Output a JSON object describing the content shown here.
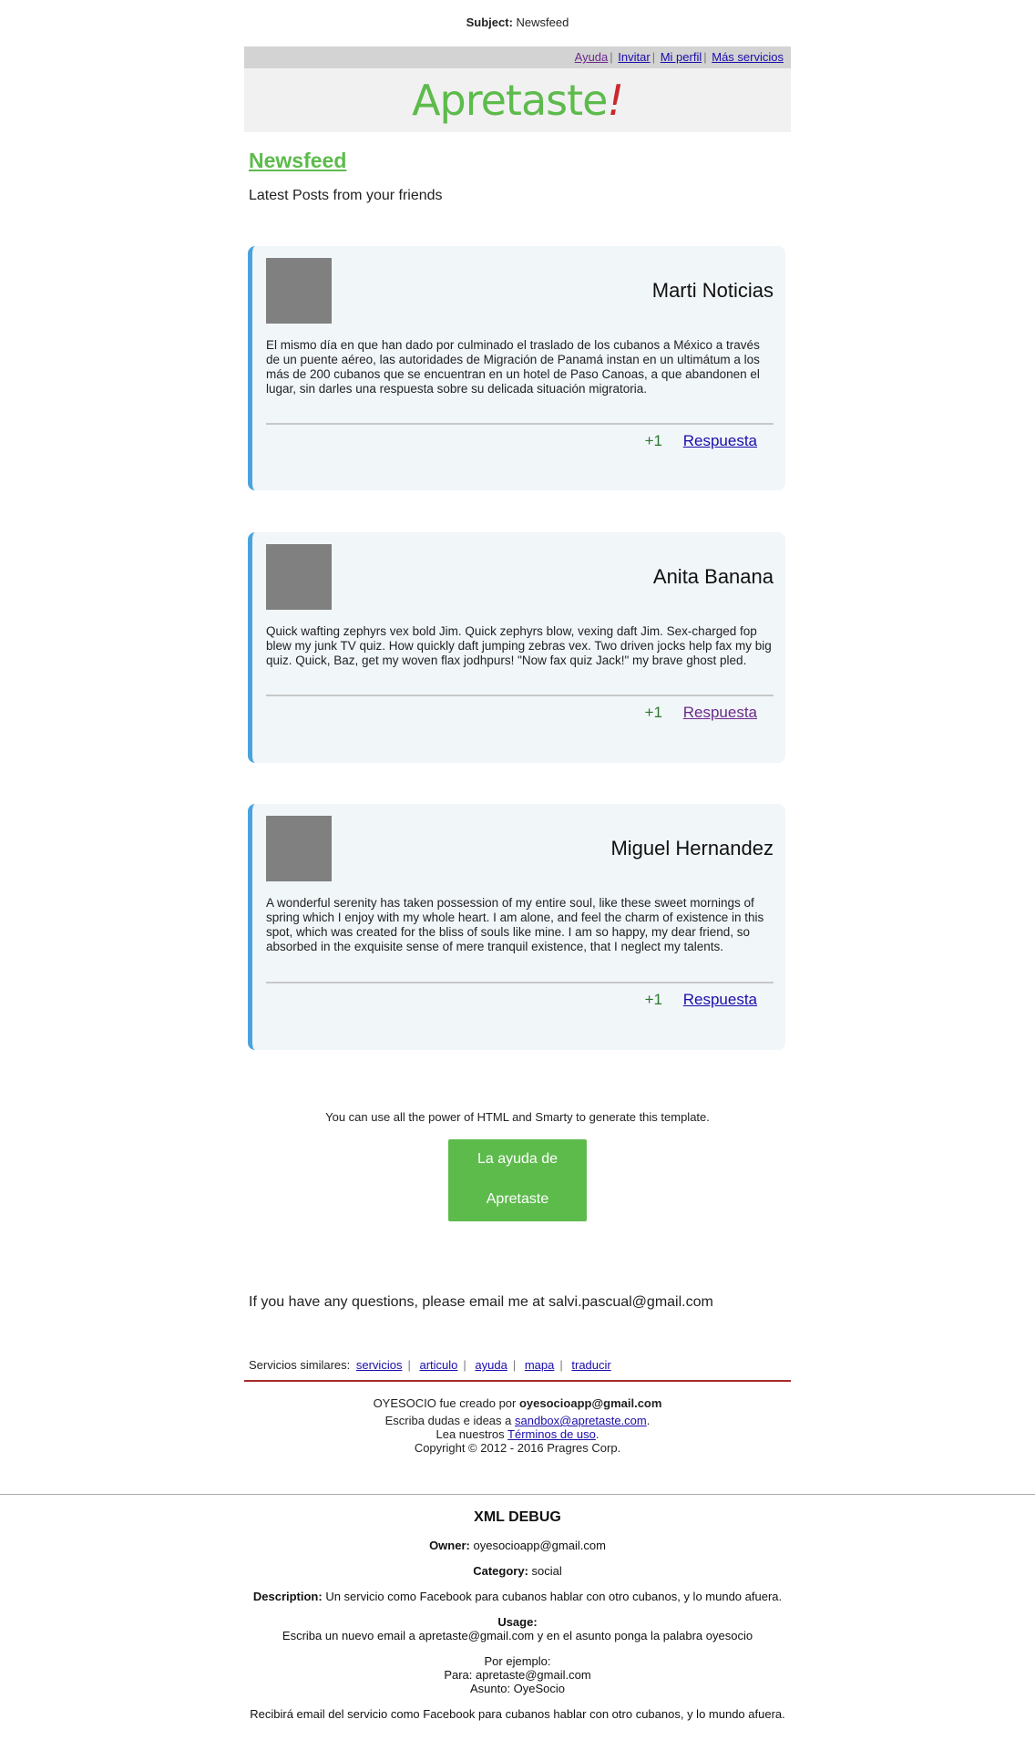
{
  "subject": {
    "label": "Subject:",
    "value": "Newsfeed"
  },
  "topbar": {
    "links": [
      "Ayuda",
      "Invitar",
      "Mi perfil",
      "Más servicios"
    ]
  },
  "logo": {
    "text": "Apretaste",
    "accent": "!"
  },
  "page": {
    "title": "Newsfeed",
    "subtitle": "Latest Posts from your friends"
  },
  "posts": [
    {
      "author": "Marti Noticias",
      "text": "El mismo día en que han dado por culminado el traslado de los cubanos a México a través de un puente aéreo, las autoridades de Migración de Panamá instan en un ultimátum a los más de 200 cubanos que se encuentran en un hotel de Paso Canoas, a que abandonen el lugar, sin darles una respuesta sobre su delicada situación migratoria.",
      "plus": "+1",
      "reply": "Respuesta"
    },
    {
      "author": "Anita Banana",
      "text": "Quick wafting zephyrs vex bold Jim. Quick zephyrs blow, vexing daft Jim. Sex-charged fop blew my junk TV quiz. How quickly daft jumping zebras vex. Two driven jocks help fax my big quiz. Quick, Baz, get my woven flax jodhpurs! \"Now fax quiz Jack!\" my brave ghost pled.",
      "plus": "+1",
      "reply": "Respuesta"
    },
    {
      "author": "Miguel Hernandez",
      "text": "A wonderful serenity has taken possession of my entire soul, like these sweet mornings of spring which I enjoy with my whole heart. I am alone, and feel the charm of existence in this spot, which was created for the bliss of souls like mine. I am so happy, my dear friend, so absorbed in the exquisite sense of mere tranquil existence, that I neglect my talents.",
      "plus": "+1",
      "reply": "Respuesta"
    }
  ],
  "power_text": "You can use all the power of HTML and Smarty to generate this template.",
  "help_button": {
    "line1": "La ayuda de",
    "line2": "Apretaste"
  },
  "question": "If you have any questions, please email me at salvi.pascual@gmail.com",
  "similar": {
    "label": "Servicios similares:",
    "links": [
      "servicios",
      "articulo",
      "ayuda",
      "mapa",
      "traducir"
    ]
  },
  "footer": {
    "created_prefix": "OYESOCIO fue creado por",
    "created_email": "oyesocioapp@gmail.com",
    "doubts_prefix": "Escriba dudas e ideas a",
    "doubts_email": "sandbox@apretaste.com",
    "terms_prefix": "Lea nuestros",
    "terms_link": "Términos de uso",
    "copyright": "Copyright © 2012 - 2016 Pragres Corp."
  },
  "debug": {
    "title": "XML DEBUG",
    "owner_label": "Owner:",
    "owner": "oyesocioapp@gmail.com",
    "category_label": "Category:",
    "category": "social",
    "description_label": "Description:",
    "description": "Un servicio como Facebook para cubanos hablar con otro cubanos, y lo mundo afuera.",
    "usage_label": "Usage:",
    "usage": "Escriba un nuevo email a apretaste@gmail.com y en el asunto ponga la palabra oyesocio",
    "example_title": "Por ejemplo:",
    "example_to": "Para: apretaste@gmail.com",
    "example_subject": "Asunto: OyeSocio",
    "result": "Recibirá email del servicio como Facebook para cubanos hablar con otro cubanos, y lo mundo afuera."
  }
}
